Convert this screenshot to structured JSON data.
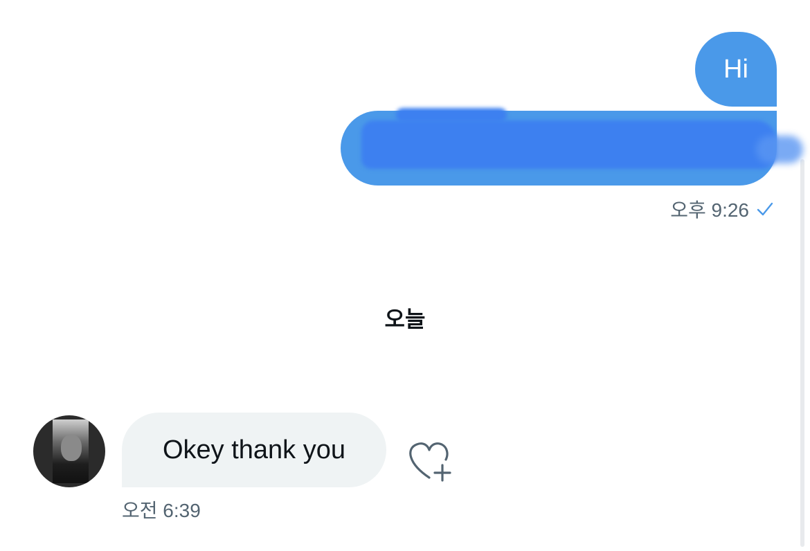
{
  "conversation": {
    "outgoing": [
      {
        "text": "Hi"
      },
      {
        "text": ""
      }
    ],
    "outgoing_time": "오후 9:26",
    "date_separator": "오늘",
    "incoming": {
      "text": "Okey thank you",
      "time": "오전 6:39"
    }
  },
  "icons": {
    "read_receipt": "check-icon",
    "react": "heart-plus-icon",
    "avatar": "avatar"
  },
  "colors": {
    "outgoing_bubble": "#4a99e9",
    "incoming_bubble": "#eff3f4",
    "secondary_text": "#536471",
    "primary_text": "#0f1419",
    "redaction": "#3d80f0"
  }
}
